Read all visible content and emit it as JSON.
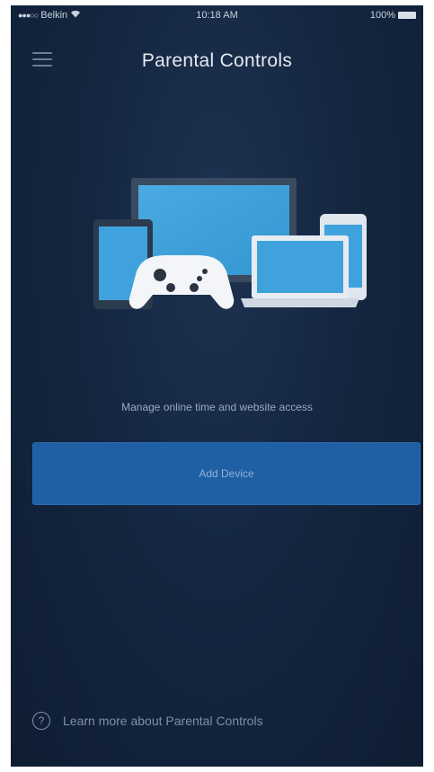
{
  "status_bar": {
    "carrier": "Belkin",
    "time": "10:18 AM",
    "battery": "100%"
  },
  "header": {
    "title": "Parental Controls",
    "menu_icon": "hamburger-menu-icon"
  },
  "illustration": {
    "icons": [
      "monitor-icon",
      "tablet-icon",
      "game-controller-icon",
      "laptop-icon",
      "phone-icon"
    ]
  },
  "main": {
    "subtitle": "Manage online time and website access",
    "add_button_label": "Add Device"
  },
  "footer": {
    "learn_more_label": "Learn more about Parental Controls",
    "help_icon_glyph": "?"
  },
  "colors": {
    "background": "#142640",
    "accent_button": "#1f5fa3",
    "title_text": "#e4eaf2",
    "muted_text": "#9aa9bd"
  }
}
